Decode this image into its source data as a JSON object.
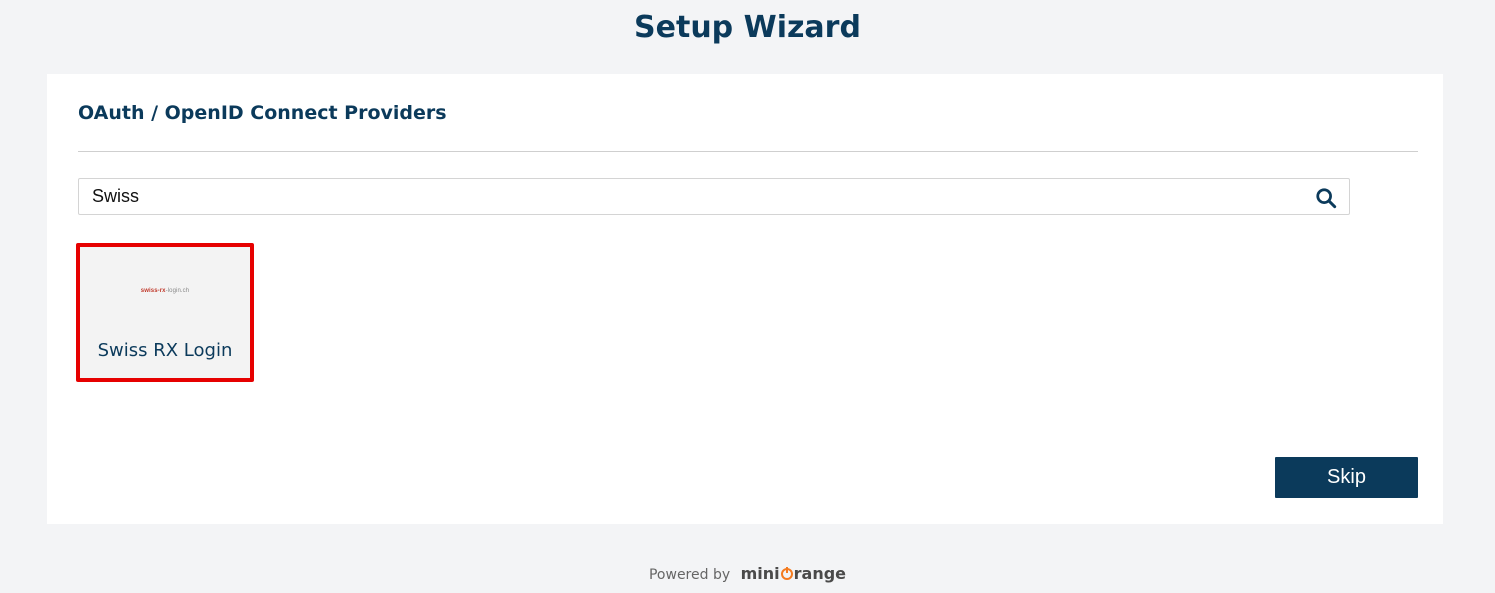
{
  "header": {
    "title": "Setup Wizard"
  },
  "section": {
    "title": "OAuth / OpenID Connect Providers"
  },
  "search": {
    "value": "Swiss",
    "icon": "search-icon"
  },
  "providers": [
    {
      "name": "Swiss RX Login",
      "logo_main": "swiss-rx",
      "logo_rest": "-login.ch",
      "selected": true,
      "highlight_color": "#e60000"
    }
  ],
  "actions": {
    "skip_label": "Skip"
  },
  "footer": {
    "powered_by": "Powered by",
    "brand_prefix": "mini",
    "brand_suffix": "range"
  },
  "colors": {
    "primary": "#0b3a5b",
    "background": "#f3f4f6",
    "brand_accent": "#f47b20"
  }
}
